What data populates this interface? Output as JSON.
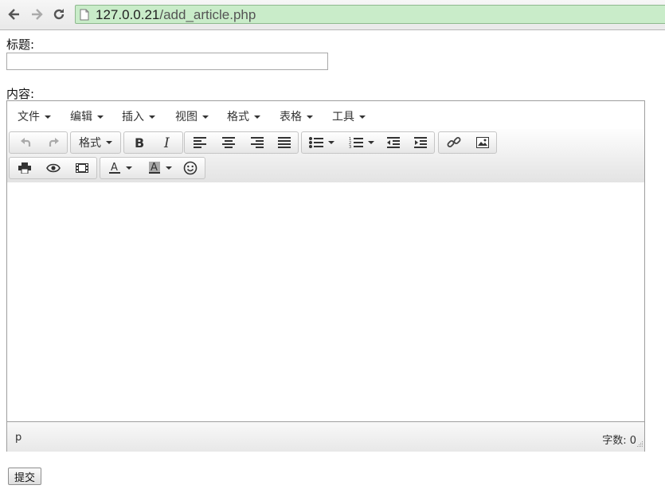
{
  "browser": {
    "url_host": "127.0.0.21",
    "url_path": "/add_article.php"
  },
  "form": {
    "title_label": "标题:",
    "title_value": "",
    "content_label": "内容:",
    "submit_label": "提交"
  },
  "editor": {
    "menu": [
      "文件",
      "编辑",
      "插入",
      "视图",
      "格式",
      "表格",
      "工具"
    ],
    "format_label": "格式",
    "status_path": "p",
    "word_count": "字数: 0",
    "icons": [
      "undo-icon",
      "redo-icon",
      "bold-icon",
      "italic-icon",
      "align-left-icon",
      "align-center-icon",
      "align-right-icon",
      "align-justify-icon",
      "bullet-list-icon",
      "numbered-list-icon",
      "outdent-icon",
      "indent-icon",
      "link-icon",
      "image-icon",
      "print-icon",
      "preview-icon",
      "media-icon",
      "text-color-icon",
      "background-color-icon",
      "emoticons-icon"
    ]
  }
}
